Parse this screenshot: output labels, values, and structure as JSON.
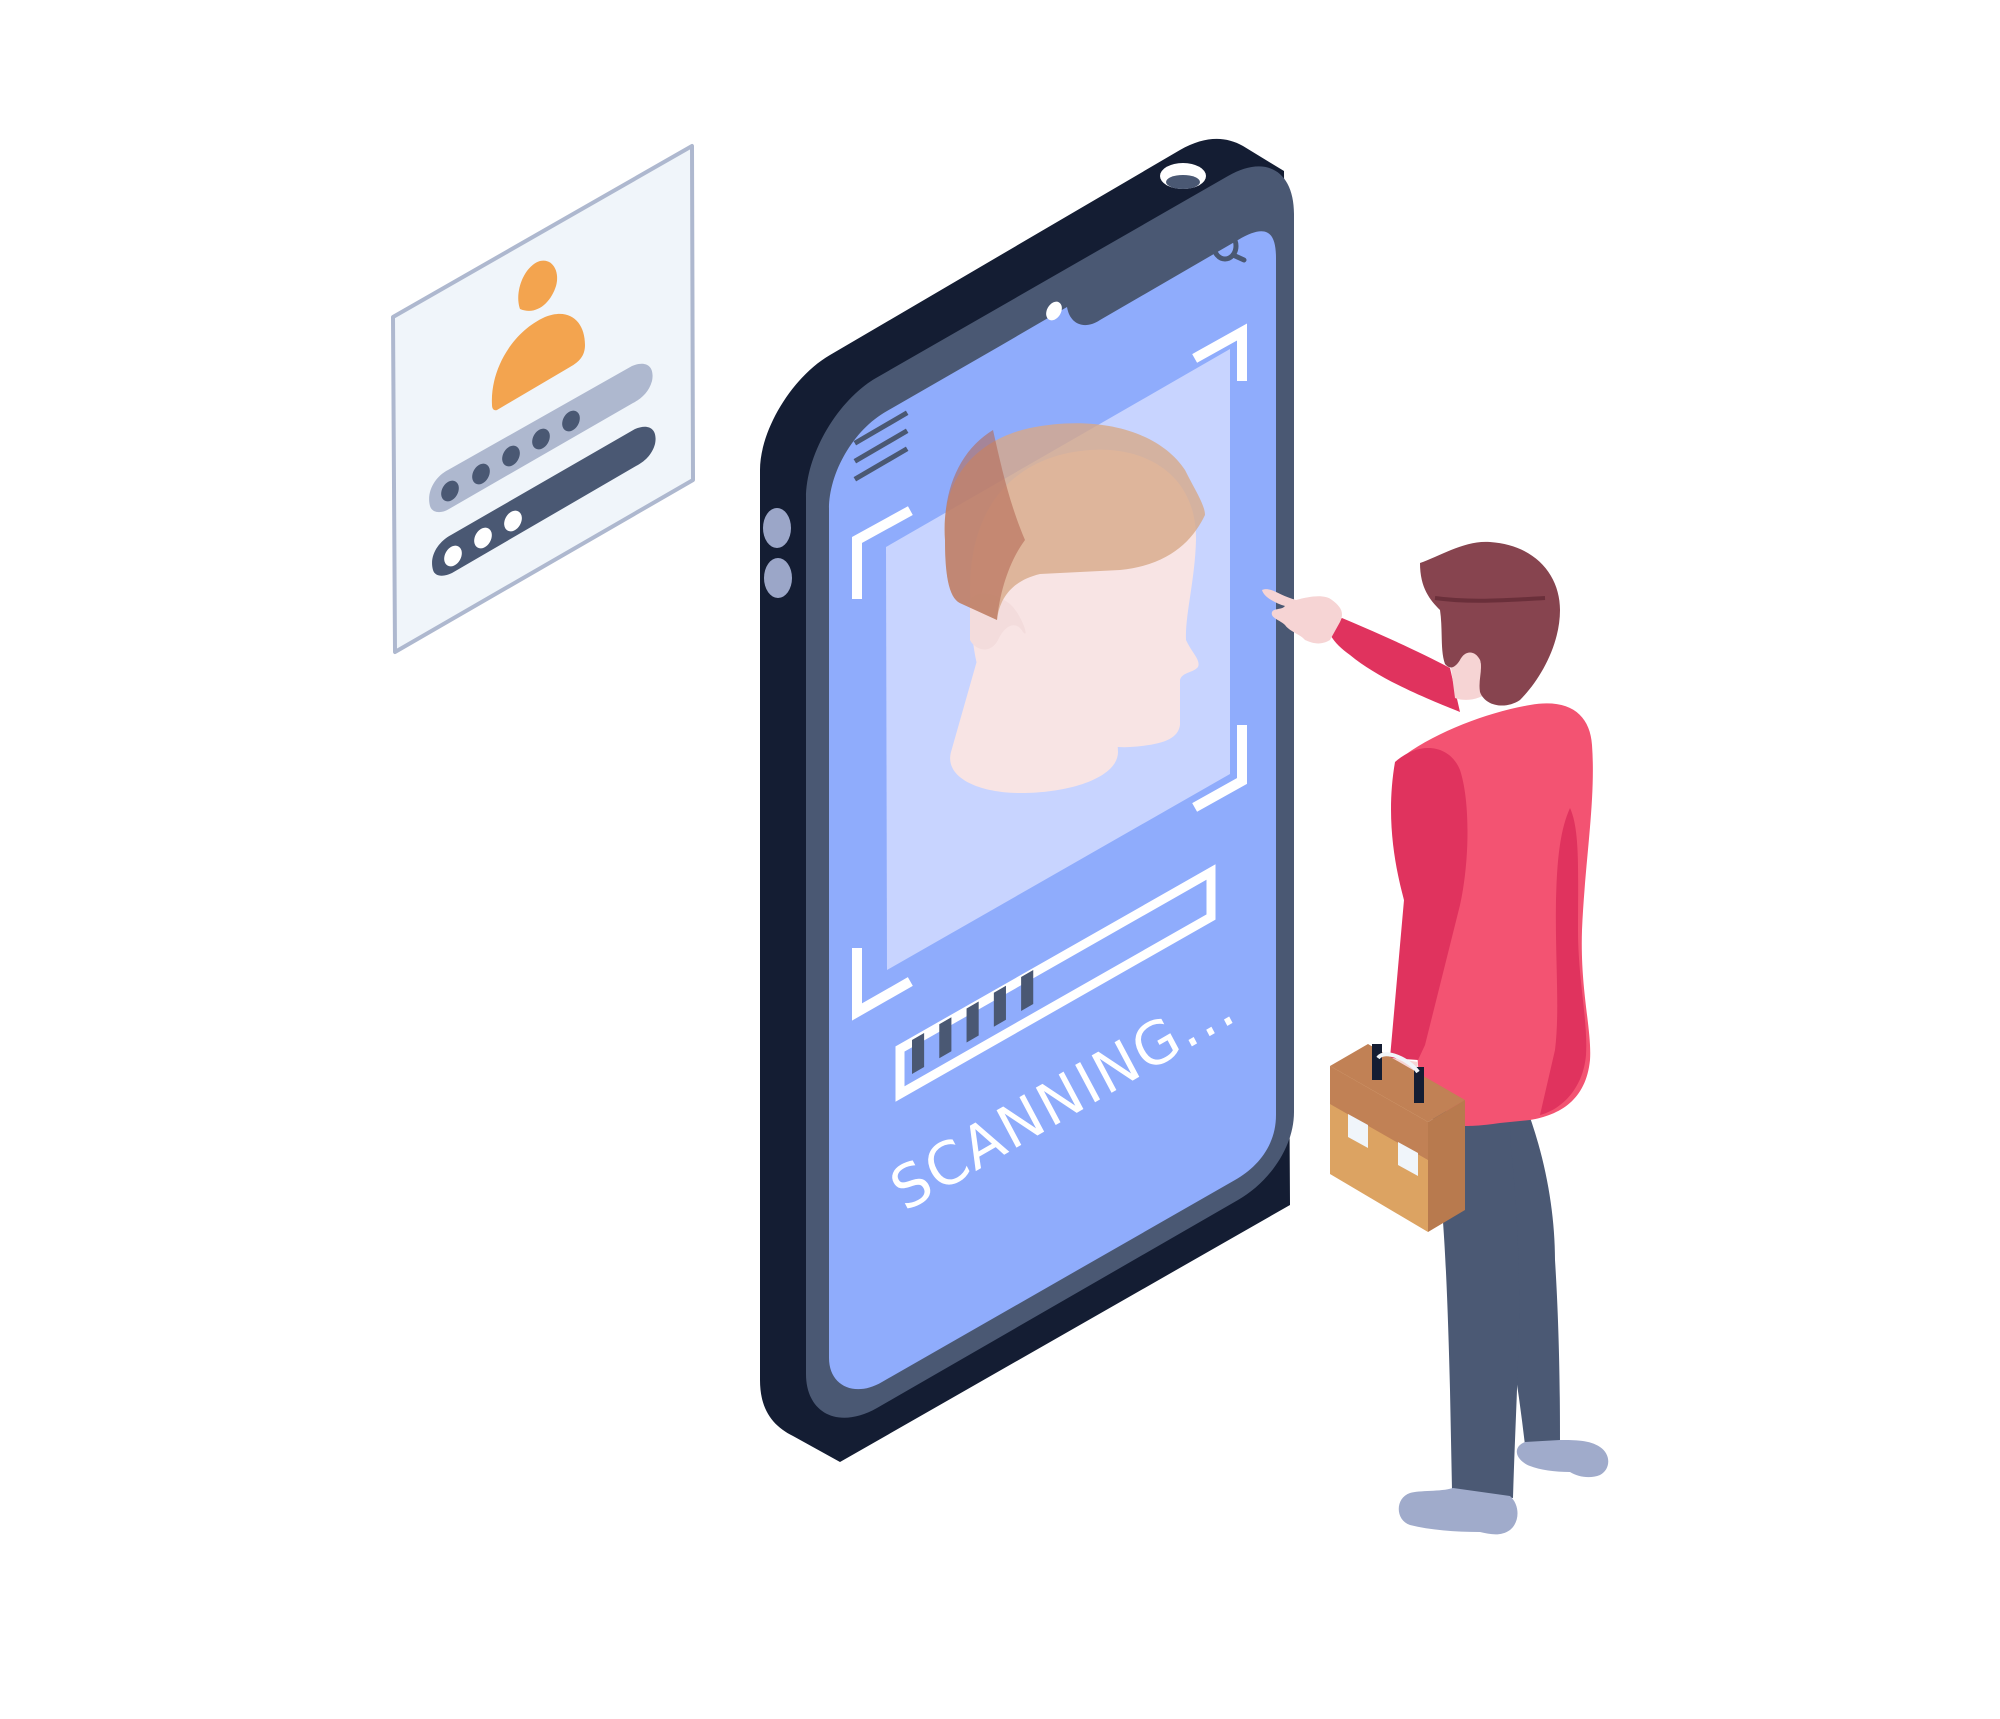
{
  "screen": {
    "status_text": "SCANNING...",
    "progress_segments_filled": 5
  },
  "icons": {
    "top_right": "search-icon",
    "menu": "hamburger-menu-icon",
    "login_card": "user-avatar-icon",
    "scan_target": "face-scan-icon",
    "bag": "briefcase-icon"
  },
  "login_card": {
    "username_dots": 5,
    "password_dots": 3
  },
  "colors": {
    "phone_body": "#141d33",
    "phone_bezel": "#4a5873",
    "screen": "#8facfc",
    "scan_window": "#c8d4ff",
    "card_bg": "#f0f5fa",
    "card_border": "#aeb8cf",
    "avatar": "#f3a44f",
    "jacket": "#f35372",
    "jacket_shadow": "#e0335e",
    "hair": "#87444f",
    "trousers": "#4b5974",
    "shoes": "#a0abcb",
    "briefcase": "#dca362"
  }
}
